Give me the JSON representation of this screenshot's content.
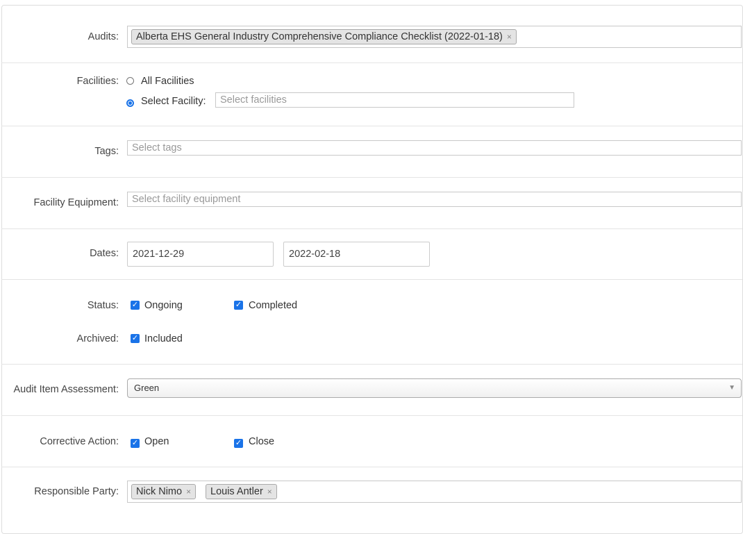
{
  "audits": {
    "label": "Audits:",
    "selected": [
      {
        "label": "Alberta EHS General Industry Comprehensive Compliance Checklist (2022-01-18)",
        "remove_icon": "×"
      }
    ]
  },
  "facilities": {
    "label": "Facilities:",
    "option_all": "All Facilities",
    "option_select": "Select Facility:",
    "selected_option": "select",
    "placeholder": "Select facilities"
  },
  "tags": {
    "label": "Tags:",
    "placeholder": "Select tags"
  },
  "equipment": {
    "label": "Facility Equipment:",
    "placeholder": "Select facility equipment"
  },
  "dates": {
    "label": "Dates:",
    "start": "2021-12-29",
    "end": "2022-02-18"
  },
  "status": {
    "label": "Status:",
    "ongoing": {
      "label": "Ongoing",
      "checked": true
    },
    "completed": {
      "label": "Completed",
      "checked": true
    }
  },
  "archived": {
    "label": "Archived:",
    "included": {
      "label": "Included",
      "checked": true
    }
  },
  "assessment": {
    "label": "Audit Item Assessment:",
    "value": "Green",
    "arrow_icon": "▼"
  },
  "corrective": {
    "label": "Corrective Action:",
    "open": {
      "label": "Open",
      "checked": true
    },
    "close": {
      "label": "Close",
      "checked": true
    }
  },
  "responsible": {
    "label": "Responsible Party:",
    "selected": [
      {
        "label": "Nick Nimo",
        "remove_icon": "×"
      },
      {
        "label": "Louis Antler",
        "remove_icon": "×"
      }
    ]
  },
  "colors": {
    "accent": "#1a73e8",
    "border": "#dddddd",
    "token_bg": "#e4e4e4"
  },
  "icons": {
    "checkbox_checked": "check-icon",
    "token_remove": "close-icon",
    "dropdown": "chevron-down-icon"
  }
}
